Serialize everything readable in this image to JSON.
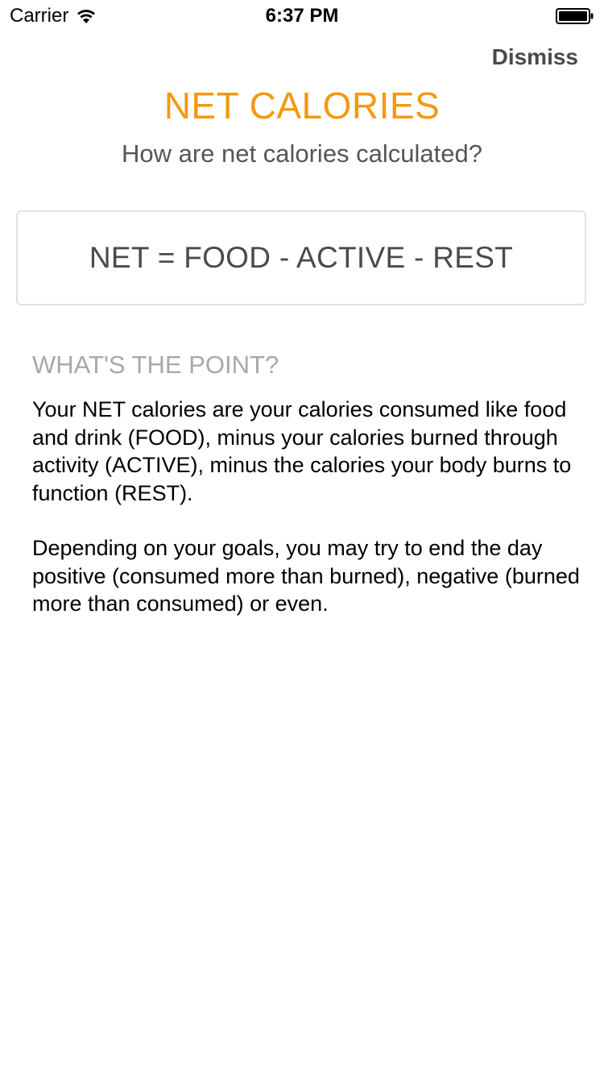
{
  "status_bar": {
    "carrier": "Carrier",
    "time": "6:37 PM",
    "wifi_icon": "wifi-icon",
    "battery_icon": "battery-icon"
  },
  "header": {
    "dismiss_label": "Dismiss"
  },
  "main": {
    "title": "NET CALORIES",
    "subtitle": "How are net calories calculated?",
    "formula": "NET = FOOD - ACTIVE - REST",
    "section_heading": "WHAT'S THE POINT?",
    "paragraph_1": "Your NET calories are your calories consumed like food and drink (FOOD), minus your calories burned through activity (ACTIVE), minus the calories your body burns to function (REST).",
    "paragraph_2": "Depending on your goals, you may try to end the day positive (consumed more than burned), negative (burned more than consumed) or even."
  },
  "colors": {
    "accent": "#f5980f",
    "heading_gray": "#a8a8a8",
    "text_dark": "#4a4a4a",
    "border": "#e2e2e2"
  }
}
